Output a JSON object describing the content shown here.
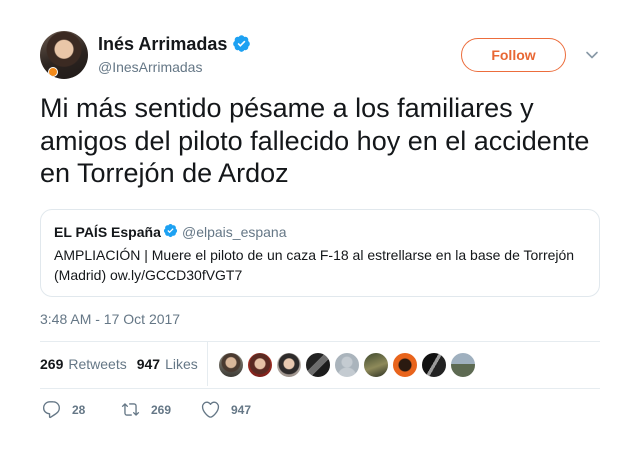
{
  "author": {
    "name": "Inés Arrimadas",
    "handle": "@InesArrimadas",
    "verified": true
  },
  "follow_label": "Follow",
  "tweet_text": "Mi más sentido pésame a los familiares y amigos del piloto fallecido hoy en el accidente en Torrejón de Ardoz",
  "quoted": {
    "name": "EL PAÍS España",
    "handle": "@elpais_espana",
    "text": "AMPLIACIÓN | Muere el piloto de un caza F-18 al estrellarse en la base de Torrejón (Madrid) ow.ly/GCCD30fVGT7"
  },
  "timestamp": "3:48 AM - 17 Oct 2017",
  "stats": {
    "retweets_count": "269",
    "retweets_label": "Retweets",
    "likes_count": "947",
    "likes_label": "Likes"
  },
  "actions": {
    "reply_count": "28",
    "retweet_count": "269",
    "like_count": "947"
  },
  "colors": {
    "verified": "#1da1f2",
    "follow_accent": "#e86734",
    "muted": "#657786"
  },
  "likers_avatars": [
    "avatar-1",
    "avatar-2",
    "avatar-3",
    "avatar-4",
    "avatar-5",
    "avatar-6",
    "avatar-7",
    "avatar-8",
    "avatar-9"
  ]
}
